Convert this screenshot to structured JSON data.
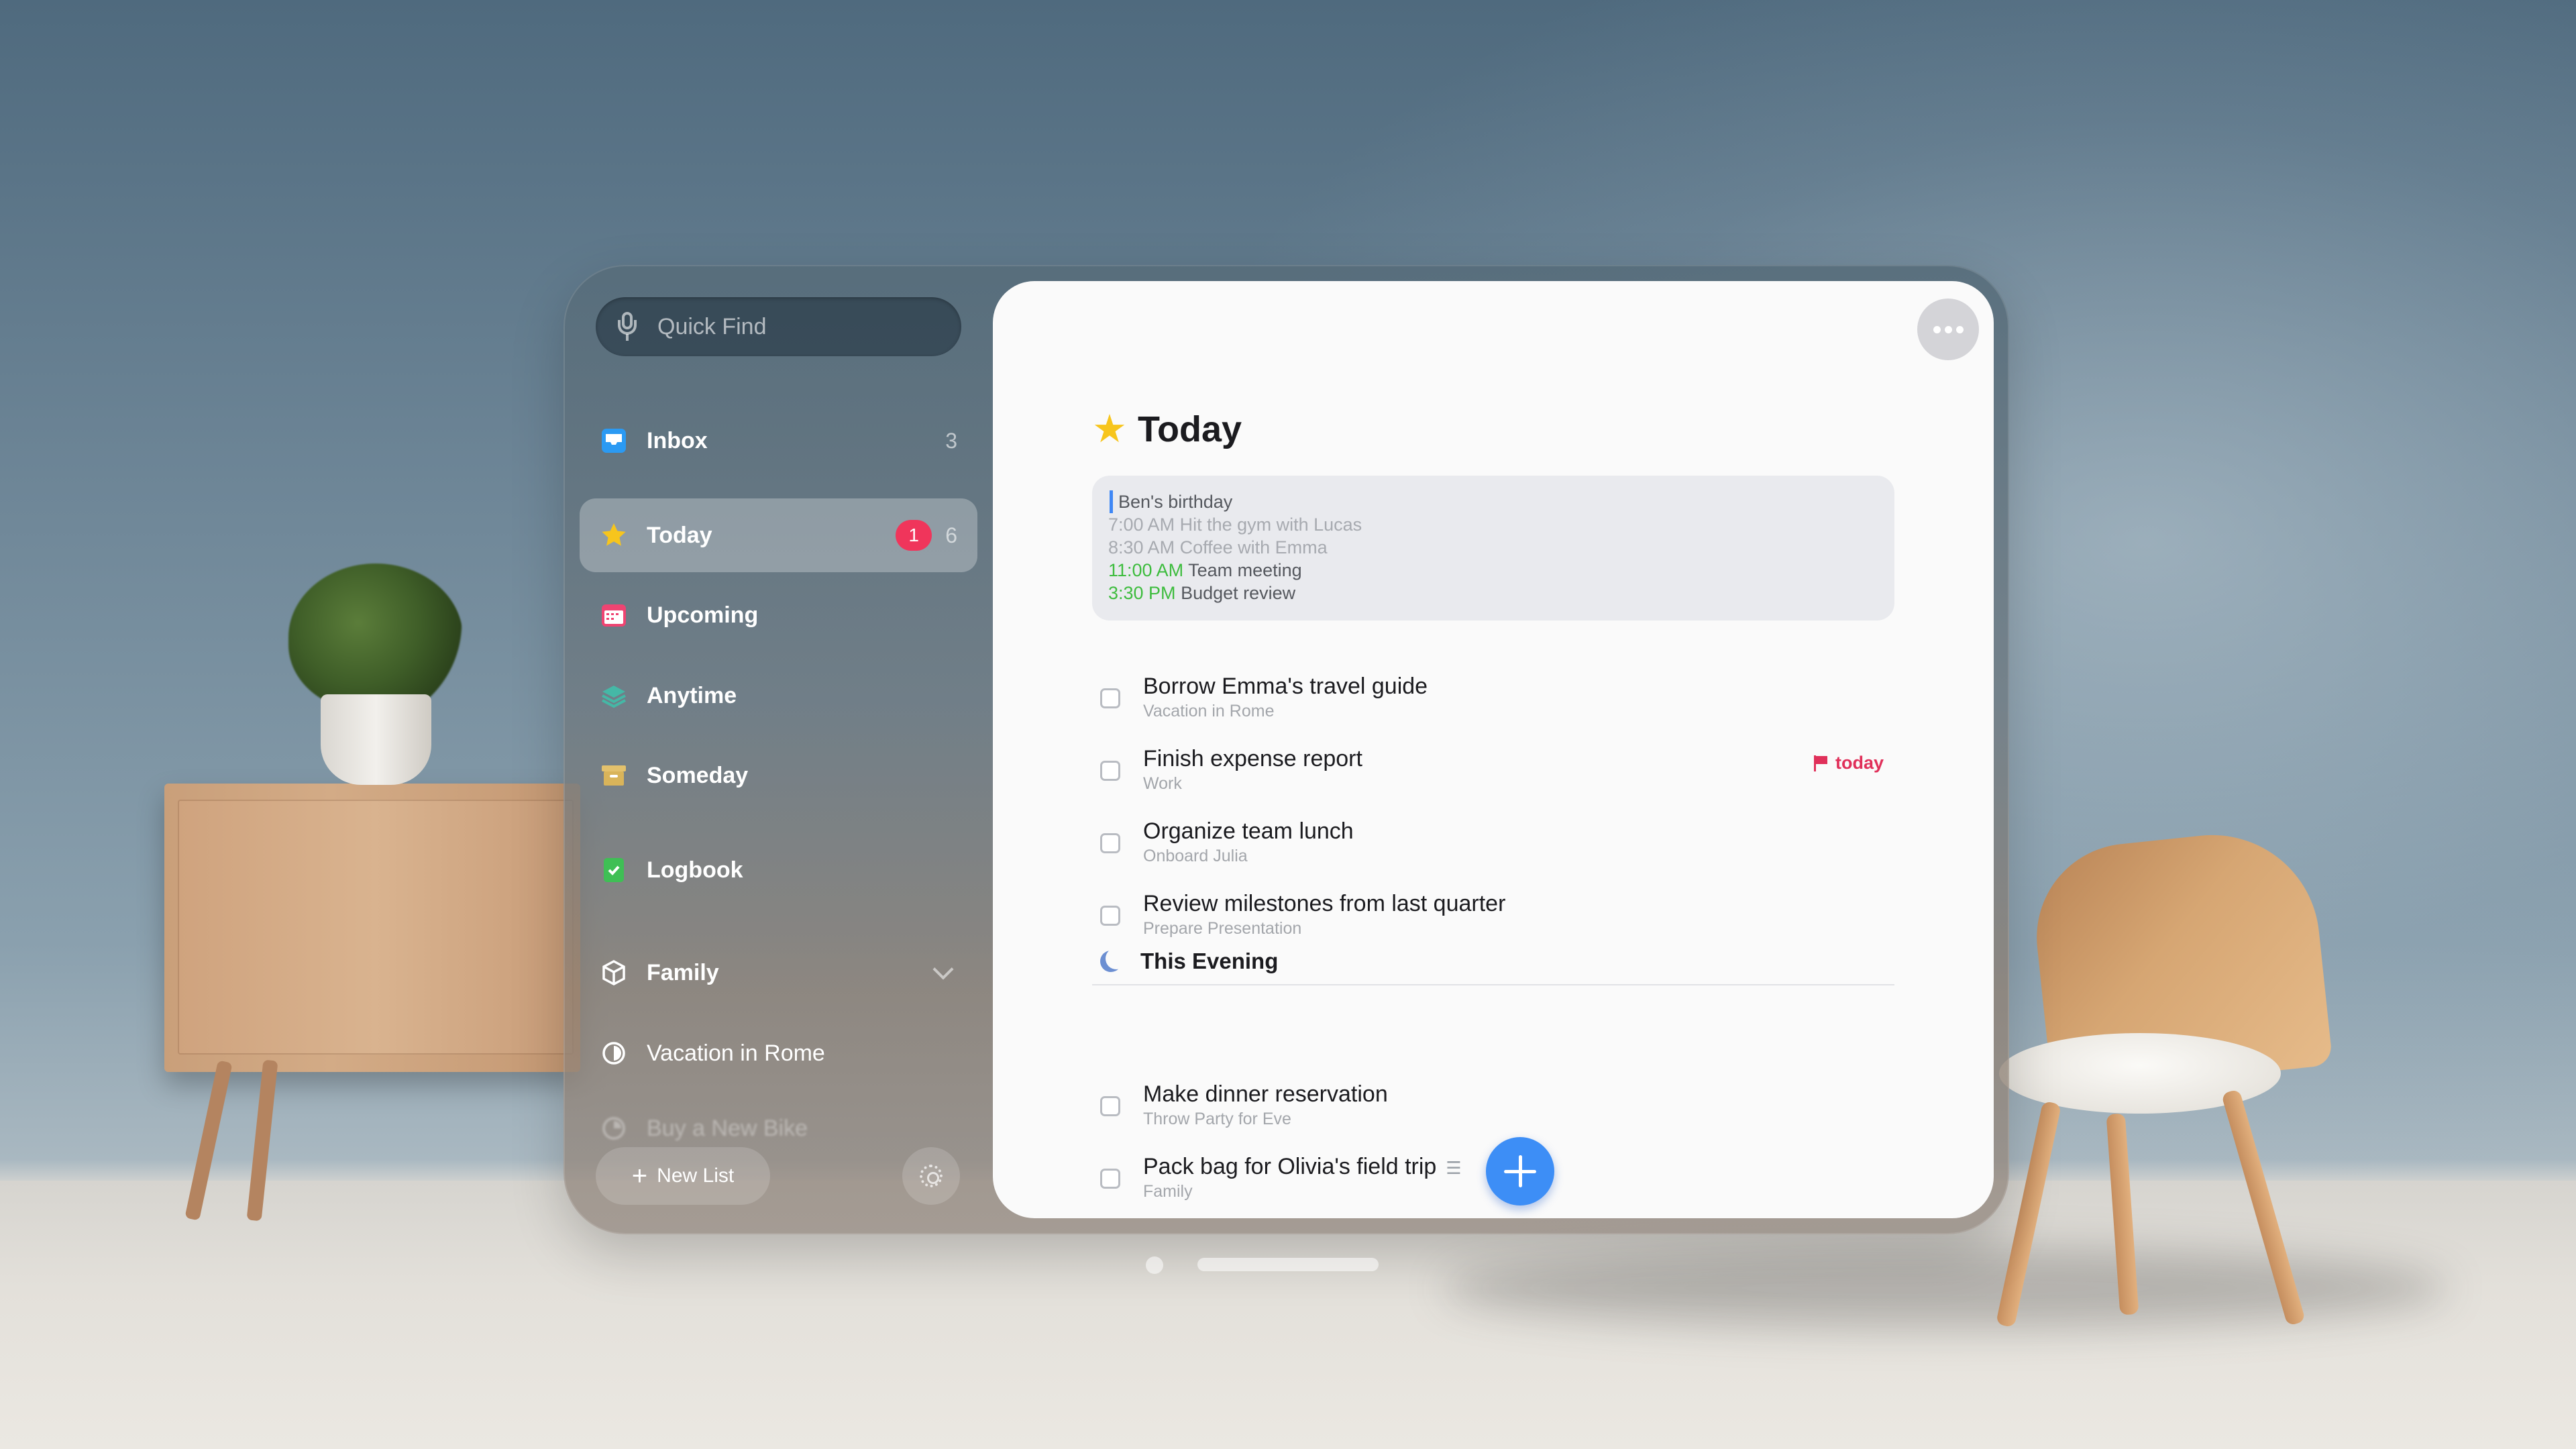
{
  "sidebar": {
    "search_placeholder": "Quick Find",
    "inbox": {
      "label": "Inbox",
      "count": "3"
    },
    "today": {
      "label": "Today",
      "badge": "1",
      "count": "6"
    },
    "upcoming": {
      "label": "Upcoming"
    },
    "anytime": {
      "label": "Anytime"
    },
    "someday": {
      "label": "Someday"
    },
    "logbook": {
      "label": "Logbook"
    },
    "family": {
      "label": "Family"
    },
    "vacation": {
      "label": "Vacation in Rome"
    },
    "bike": {
      "label": "Buy a New Bike"
    },
    "new_list_label": "New List"
  },
  "main": {
    "title": "Today",
    "calendar": {
      "all_day": "Ben's birthday",
      "events": [
        {
          "time": "7:00 AM",
          "title": "Hit the gym with Lucas"
        },
        {
          "time": "8:30 AM",
          "title": "Coffee with Emma"
        },
        {
          "time": "11:00 AM",
          "title": "Team meeting"
        },
        {
          "time": "3:30 PM",
          "title": "Budget review"
        }
      ]
    },
    "tasks": [
      {
        "title": "Borrow Emma's travel guide",
        "project": "Vacation in Rome"
      },
      {
        "title": "Finish expense report",
        "project": "Work",
        "deadline": "today"
      },
      {
        "title": "Organize team lunch",
        "project": "Onboard Julia"
      },
      {
        "title": "Review milestones from last quarter",
        "project": "Prepare Presentation"
      }
    ],
    "evening_title": "This Evening",
    "evening_tasks": [
      {
        "title": "Make dinner reservation",
        "project": "Throw Party for Eve"
      },
      {
        "title": "Pack bag for Olivia's field trip",
        "project": "Family"
      }
    ]
  },
  "colors": {
    "accent_blue": "#3d8ef6",
    "today_star": "#f7c51d",
    "badge_red": "#f0355b",
    "deadline_red": "#e0305a",
    "evening_green": "#3dbc3d"
  }
}
